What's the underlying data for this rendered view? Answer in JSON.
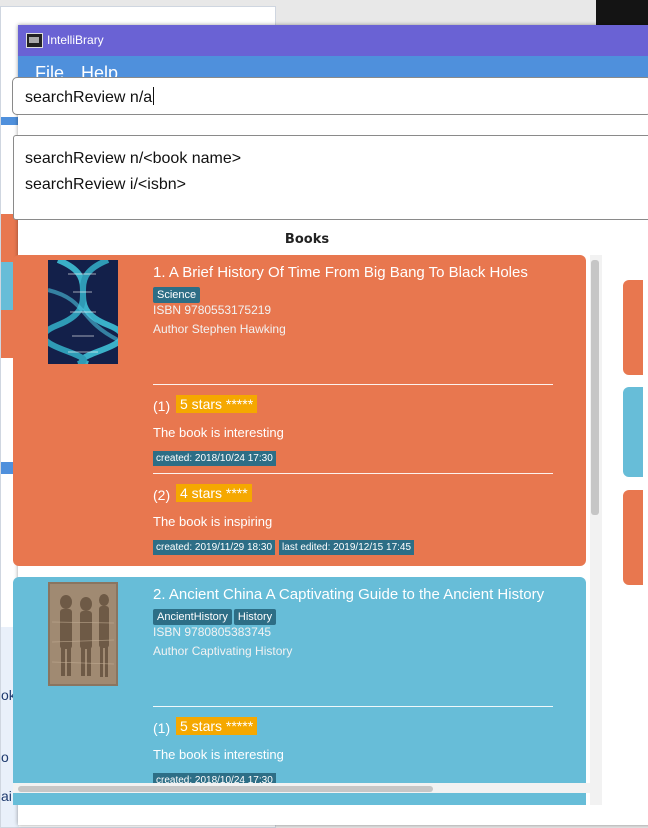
{
  "window": {
    "title": "IntelliBrary"
  },
  "menu": {
    "file": "File",
    "help": "Help"
  },
  "command": {
    "value": "searchReview n/a"
  },
  "result": {
    "line1": "searchReview n/<book name>",
    "line2": "searchReview i/<isbn>"
  },
  "panel": {
    "label": "Books"
  },
  "colors": {
    "orange_card": "#e8774f",
    "blue_card": "#67bdd8",
    "star_badge": "#f5a800",
    "tag": "#2d6e86",
    "titlebar": "#6a62d4",
    "menubar": "#4f90dc"
  },
  "books": [
    {
      "title": "1.  A Brief History Of Time From Big Bang To Black Holes",
      "tags": [
        "Science"
      ],
      "isbn": "ISBN 9780553175219",
      "author": "Author Stephen Hawking",
      "reviews": [
        {
          "index": "(1)",
          "stars": "5 stars *****",
          "text": "The book is interesting",
          "created": "created: 2018/10/24 17:30"
        },
        {
          "index": "(2)",
          "stars": "4 stars ****",
          "text": "The book is inspiring",
          "created": "created: 2019/11/29 18:30",
          "edited": "last edited: 2019/12/15 17:45"
        }
      ]
    },
    {
      "title": "2.  Ancient China A Captivating Guide to the Ancient History",
      "tags": [
        "AncientHistory",
        "History"
      ],
      "isbn": "ISBN 9780805383745",
      "author": "Author Captivating History",
      "reviews": [
        {
          "index": "(1)",
          "stars": "5 stars *****",
          "text": "The book is interesting",
          "created": "created: 2018/10/24 17:30"
        }
      ]
    }
  ],
  "background": {
    "t1": "ok",
    "t2": "o 5",
    "t3": "ai"
  }
}
